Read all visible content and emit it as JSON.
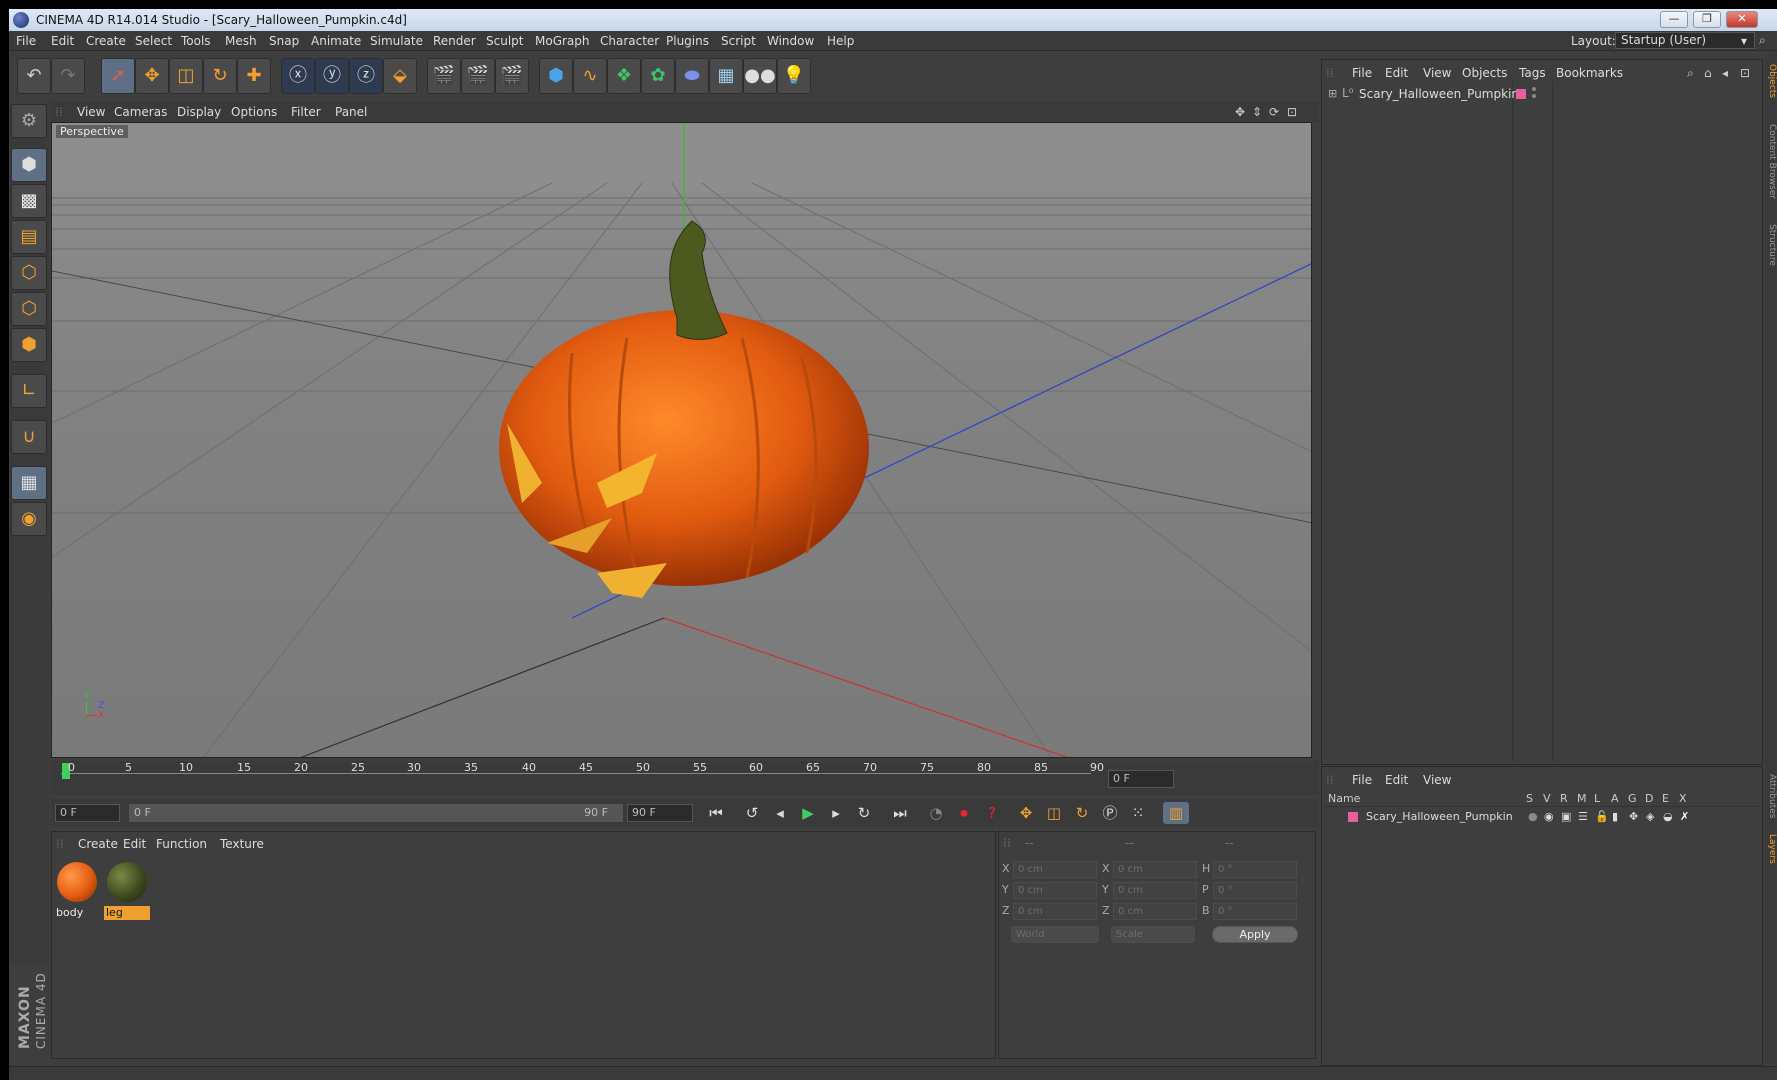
{
  "window": {
    "title": "CINEMA 4D R14.014 Studio - [Scary_Halloween_Pumpkin.c4d]",
    "min": "—",
    "max": "❐",
    "close": "✕"
  },
  "menu": [
    "File",
    "Edit",
    "Create",
    "Select",
    "Tools",
    "Mesh",
    "Snap",
    "Animate",
    "Simulate",
    "Render",
    "Sculpt",
    "MoGraph",
    "Character",
    "Plugins",
    "Script",
    "Window",
    "Help"
  ],
  "layout": {
    "label": "Layout:",
    "value": "Startup (User)"
  },
  "viewport": {
    "menu": [
      "View",
      "Cameras",
      "Display",
      "Options",
      "Filter",
      "Panel"
    ],
    "label": "Perspective",
    "axes": {
      "y": "Y",
      "z": "Z",
      "x": "X"
    }
  },
  "timeline": {
    "ticks": [
      "0",
      "5",
      "10",
      "15",
      "20",
      "25",
      "30",
      "35",
      "40",
      "45",
      "50",
      "55",
      "60",
      "65",
      "70",
      "75",
      "80",
      "85",
      "90"
    ],
    "current_frame": "0 F",
    "start_frame": "0 F",
    "range_start": "0 F",
    "range_end": "90 F",
    "end_frame": "90 F"
  },
  "material_panel": {
    "menu": [
      "Create",
      "Edit",
      "Function",
      "Texture"
    ],
    "materials": [
      {
        "name": "body",
        "color": "#e25b10"
      },
      {
        "name": "leg",
        "color": "#3f4a1e"
      }
    ]
  },
  "coordinates": {
    "headers": [
      "--",
      "--",
      "--"
    ],
    "rows": [
      {
        "a": "X",
        "av": "0 cm",
        "b": "X",
        "bv": "0 cm",
        "c": "H",
        "cv": "0 °"
      },
      {
        "a": "Y",
        "av": "0 cm",
        "b": "Y",
        "bv": "0 cm",
        "c": "P",
        "cv": "0 °"
      },
      {
        "a": "Z",
        "av": "0 cm",
        "b": "Z",
        "bv": "0 cm",
        "c": "B",
        "cv": "0 °"
      }
    ],
    "mode": "World",
    "transform": "Scale",
    "apply": "Apply"
  },
  "objects_panel": {
    "menu": [
      "File",
      "Edit",
      "View",
      "Objects",
      "Tags",
      "Bookmarks"
    ],
    "items": [
      {
        "name": "Scary_Halloween_Pumpkin",
        "color": "#e85fa0"
      }
    ]
  },
  "layers_panel": {
    "menu": [
      "File",
      "Edit",
      "View"
    ],
    "col_name": "Name",
    "cols": [
      "S",
      "V",
      "R",
      "M",
      "L",
      "A",
      "G",
      "D",
      "E",
      "X"
    ],
    "items": [
      {
        "name": "Scary_Halloween_Pumpkin",
        "color": "#e85fa0"
      }
    ]
  },
  "side_tabs": [
    "Objects",
    "Content Browser",
    "Structure",
    "Attributes",
    "Layers"
  ],
  "brand": {
    "name": "MAXON",
    "product": "CINEMA 4D"
  }
}
